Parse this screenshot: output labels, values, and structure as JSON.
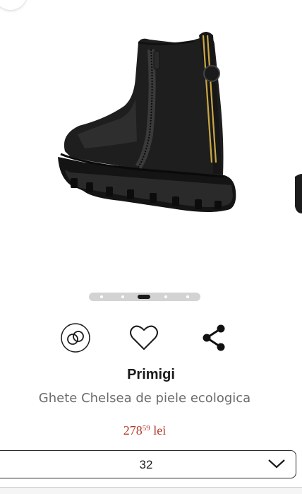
{
  "product": {
    "brand": "Primigi",
    "title": "Ghete Chelsea de piele ecologica",
    "price_main": "278",
    "price_cents": "59",
    "price_currency": "lei"
  },
  "gallery": {
    "current_image": 3,
    "image_count": 5
  },
  "actions": {
    "compare_icon": "compare-rings-icon",
    "favorite_icon": "heart-icon",
    "share_icon": "share-icon"
  },
  "size_selector": {
    "selected": "32",
    "chevron_icon": "chevron-down-icon"
  },
  "colors": {
    "price": "#b33a2a",
    "brand_text": "#1a1a1a",
    "title_text": "#6b6b6b",
    "boot": "#1c1c1c",
    "stripe": "#c9a646"
  }
}
